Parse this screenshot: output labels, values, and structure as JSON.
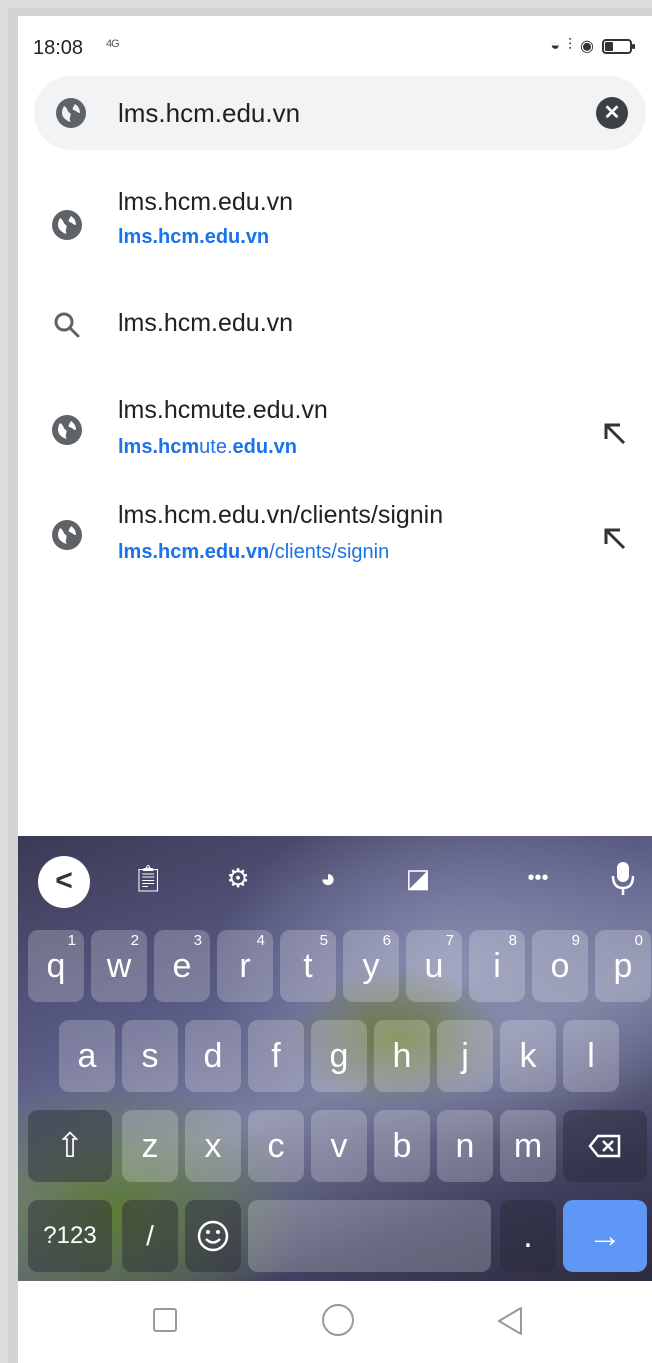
{
  "status_bar": {
    "time": "18:08",
    "network": "4G"
  },
  "address_bar": {
    "text": "lms.hcm.edu.vn",
    "clear_label": "✕"
  },
  "suggestions": [
    {
      "title": "lms.hcm.edu.vn",
      "url_bold": "lms.hcm.edu.vn",
      "url_rest": "",
      "icon": "globe-icon",
      "has_arrow": false
    },
    {
      "title": "lms.hcm.edu.vn",
      "icon": "search-icon",
      "has_arrow": false
    },
    {
      "title": "lms.hcmute.edu.vn",
      "url_parts": [
        "lms.hcm",
        "ute.",
        "edu.vn"
      ],
      "icon": "globe-icon",
      "has_arrow": true
    },
    {
      "title": "lms.hcm.edu.vn/clients/signin",
      "url_bold": "lms.hcm.edu.vn",
      "url_rest": "/clients/signin",
      "icon": "globe-icon",
      "has_arrow": true
    }
  ],
  "keyboard": {
    "toolbar": {
      "back": "<",
      "more": "•••"
    },
    "row1": [
      {
        "k": "q",
        "n": "1"
      },
      {
        "k": "w",
        "n": "2"
      },
      {
        "k": "e",
        "n": "3"
      },
      {
        "k": "r",
        "n": "4"
      },
      {
        "k": "t",
        "n": "5"
      },
      {
        "k": "y",
        "n": "6"
      },
      {
        "k": "u",
        "n": "7"
      },
      {
        "k": "i",
        "n": "8"
      },
      {
        "k": "o",
        "n": "9"
      },
      {
        "k": "p",
        "n": "0"
      }
    ],
    "row2": [
      "a",
      "s",
      "d",
      "f",
      "g",
      "h",
      "j",
      "k",
      "l"
    ],
    "row3": [
      "z",
      "x",
      "c",
      "v",
      "b",
      "n",
      "m"
    ],
    "bottom": {
      "symbols": "?123",
      "slash": "/",
      "period": ".",
      "enter": "→",
      "shift": "⇧"
    }
  }
}
